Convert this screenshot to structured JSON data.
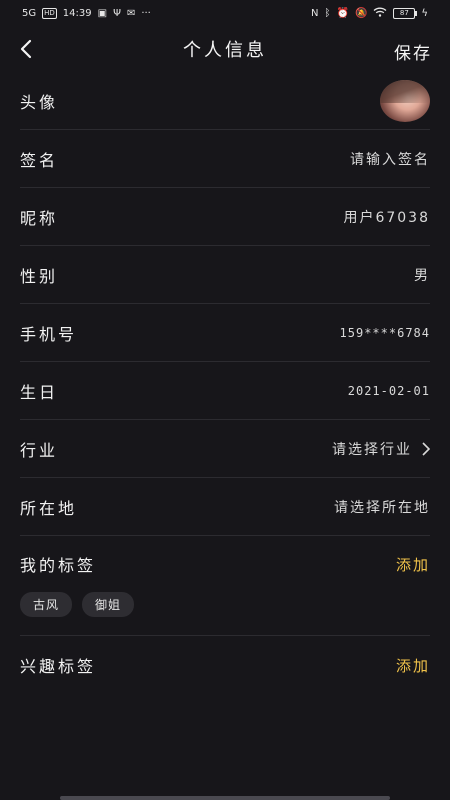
{
  "status": {
    "carrier": "5G",
    "hd": "HD",
    "time": "14:39",
    "icons_left": [
      "notification-icon",
      "usb-icon",
      "mail-icon",
      "more-icon"
    ],
    "battery": "87"
  },
  "header": {
    "title": "个人信息",
    "save_label": "保存"
  },
  "rows": [
    {
      "label": "头像",
      "value": ""
    },
    {
      "label": "签名",
      "value": "请输入签名"
    },
    {
      "label": "昵称",
      "value": "用户67038"
    },
    {
      "label": "性别",
      "value": "男"
    },
    {
      "label": "手机号",
      "value": "159****6784"
    },
    {
      "label": "生日",
      "value": "2021-02-01"
    },
    {
      "label": "行业",
      "value": "请选择行业"
    },
    {
      "label": "所在地",
      "value": "请选择所在地"
    }
  ],
  "my_tags": {
    "label": "我的标签",
    "add": "添加",
    "items": [
      "古风",
      "御姐"
    ]
  },
  "interest_tags": {
    "label": "兴趣标签",
    "add": "添加"
  },
  "colors": {
    "background": "#17161a",
    "accent": "#f0c24a"
  }
}
